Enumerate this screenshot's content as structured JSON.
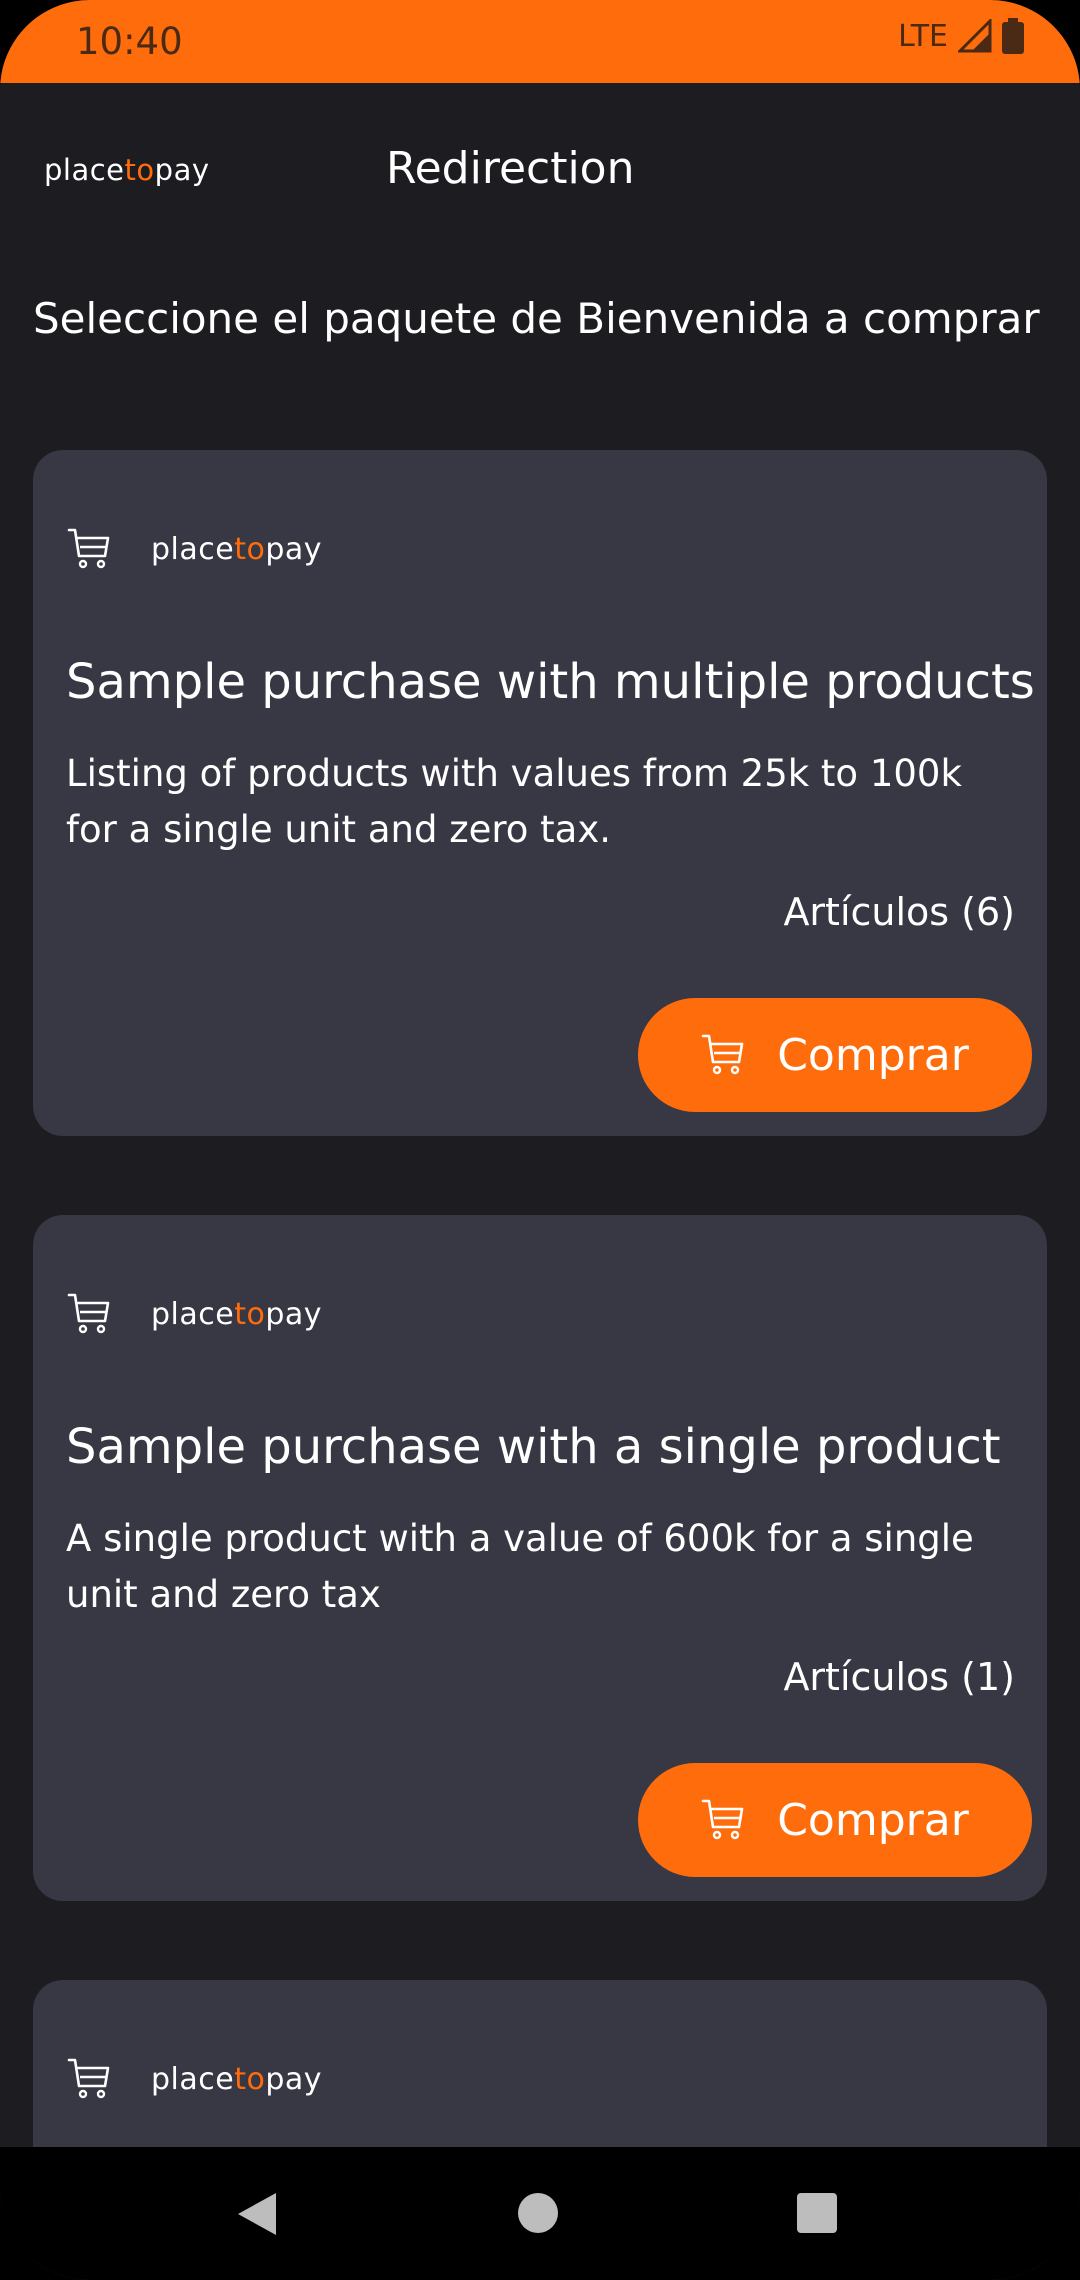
{
  "status_bar": {
    "time": "10:40",
    "network": "LTE",
    "icons": [
      "signal-icon",
      "battery-icon"
    ]
  },
  "app_bar": {
    "brand": {
      "part1": "place",
      "part2": "to",
      "part3": "pay"
    },
    "title": "Redirection"
  },
  "page": {
    "heading": "Seleccione el paquete de Bienvenida a comprar"
  },
  "colors": {
    "accent": "#ff6c0c",
    "background": "#1c1c21",
    "card": "#383844"
  },
  "cards": [
    {
      "brand": {
        "part1": "place",
        "part2": "to",
        "part3": "pay"
      },
      "title": "Sample purchase with multiple products",
      "description": "Listing of products with values from 25k to 100k for a single unit and zero tax.",
      "count": "Artículos (6)",
      "button": "Comprar"
    },
    {
      "brand": {
        "part1": "place",
        "part2": "to",
        "part3": "pay"
      },
      "title": "Sample purchase with a single product",
      "description": "A single product with a value of 600k for a single unit and zero tax",
      "count": "Artículos (1)",
      "button": "Comprar"
    },
    {
      "brand": {
        "part1": "place",
        "part2": "to",
        "part3": "pay"
      }
    }
  ],
  "nav_bar": {
    "icons": [
      "back-icon",
      "home-icon",
      "recent-apps-icon"
    ]
  }
}
